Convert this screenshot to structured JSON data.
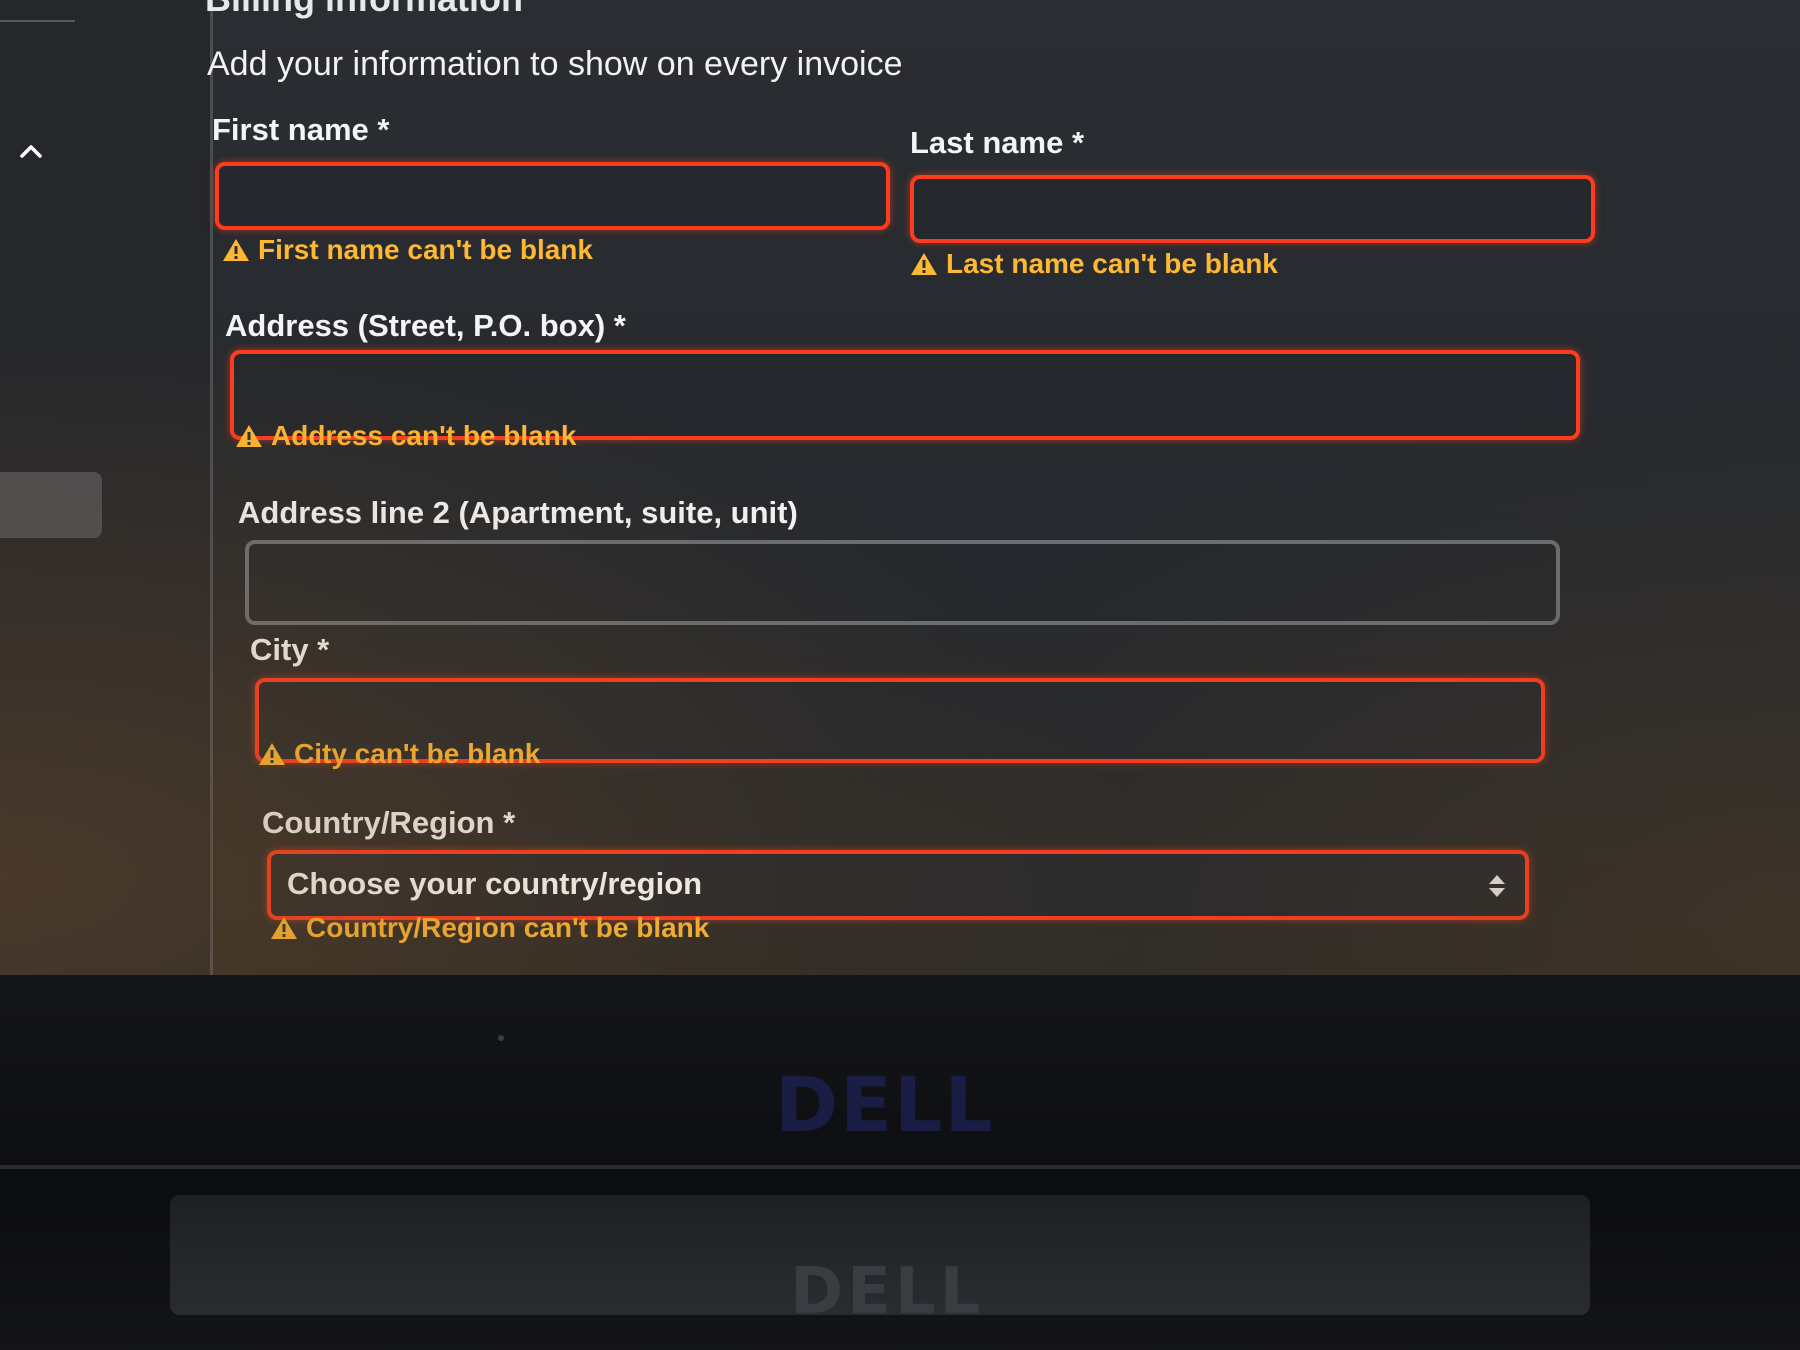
{
  "section": {
    "title": "Billing information",
    "subtitle": "Add your information to show on every invoice"
  },
  "fields": {
    "first_name": {
      "label": "First name *",
      "value": "",
      "error": "First name can't be blank"
    },
    "last_name": {
      "label": "Last name *",
      "value": "",
      "error": "Last name can't be blank"
    },
    "address": {
      "label": "Address (Street, P.O. box) *",
      "value": "",
      "error": "Address can't be blank"
    },
    "address2": {
      "label": "Address line 2 (Apartment, suite, unit)",
      "value": ""
    },
    "city": {
      "label": "City *",
      "value": "",
      "error": "City can't be blank"
    },
    "country": {
      "label": "Country/Region *",
      "selected": "Choose your country/region",
      "error": "Country/Region can't be blank"
    }
  },
  "hardware": {
    "brand": "DELL"
  },
  "icons": {
    "collapse": "chevron-up-icon",
    "warning": "warning-triangle-icon",
    "select": "select-arrows-icon"
  },
  "colors": {
    "error_border": "#ff3b1f",
    "error_text": "#ffb833",
    "background": "#26292d"
  }
}
